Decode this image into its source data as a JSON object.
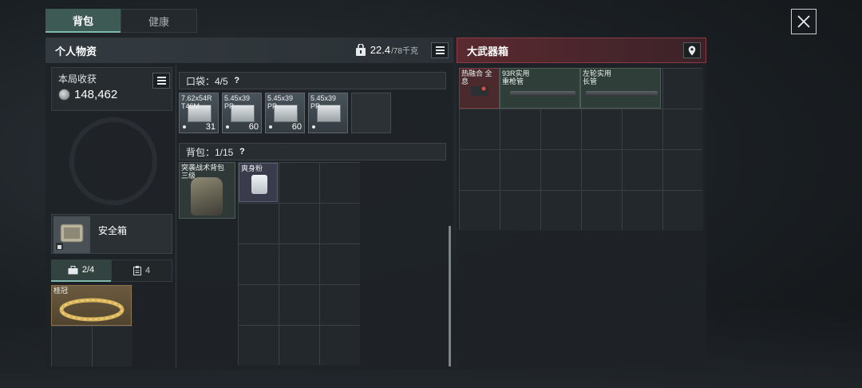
{
  "tabs": {
    "active": "背包",
    "inactive": "健康"
  },
  "personal": {
    "title": "个人物资",
    "weight_current": "22.4",
    "weight_max": "/78千克",
    "gains_label": "本局收获",
    "gains_value": "148,462",
    "safe_box_label": "安全箱",
    "case_tab_1": "2/4",
    "case_tab_2": "4",
    "case_item_label": "桂冠"
  },
  "pocket": {
    "header": "口袋：4/5",
    "help": "?",
    "slots": [
      {
        "label": "7.62x54R\nT46M",
        "count": "31"
      },
      {
        "label": "5.45x39\nPP",
        "count": "60"
      },
      {
        "label": "5.45x39\nPP",
        "count": "60"
      },
      {
        "label": "5.45x39\nPP",
        "count": ""
      }
    ]
  },
  "backpack": {
    "header": "背包：1/15",
    "help": "?",
    "item1_label": "突袭战术背包\n三级",
    "item2_label": "爽身粉"
  },
  "crate": {
    "title": "大武器箱",
    "items": [
      {
        "label": "热融合 全息"
      },
      {
        "label": "93R实用\n重枪管"
      },
      {
        "label": "左轮实用\n长管"
      }
    ]
  },
  "colors": {
    "accent_green": "#7fb9ad",
    "crate_red": "#8c3a44"
  }
}
